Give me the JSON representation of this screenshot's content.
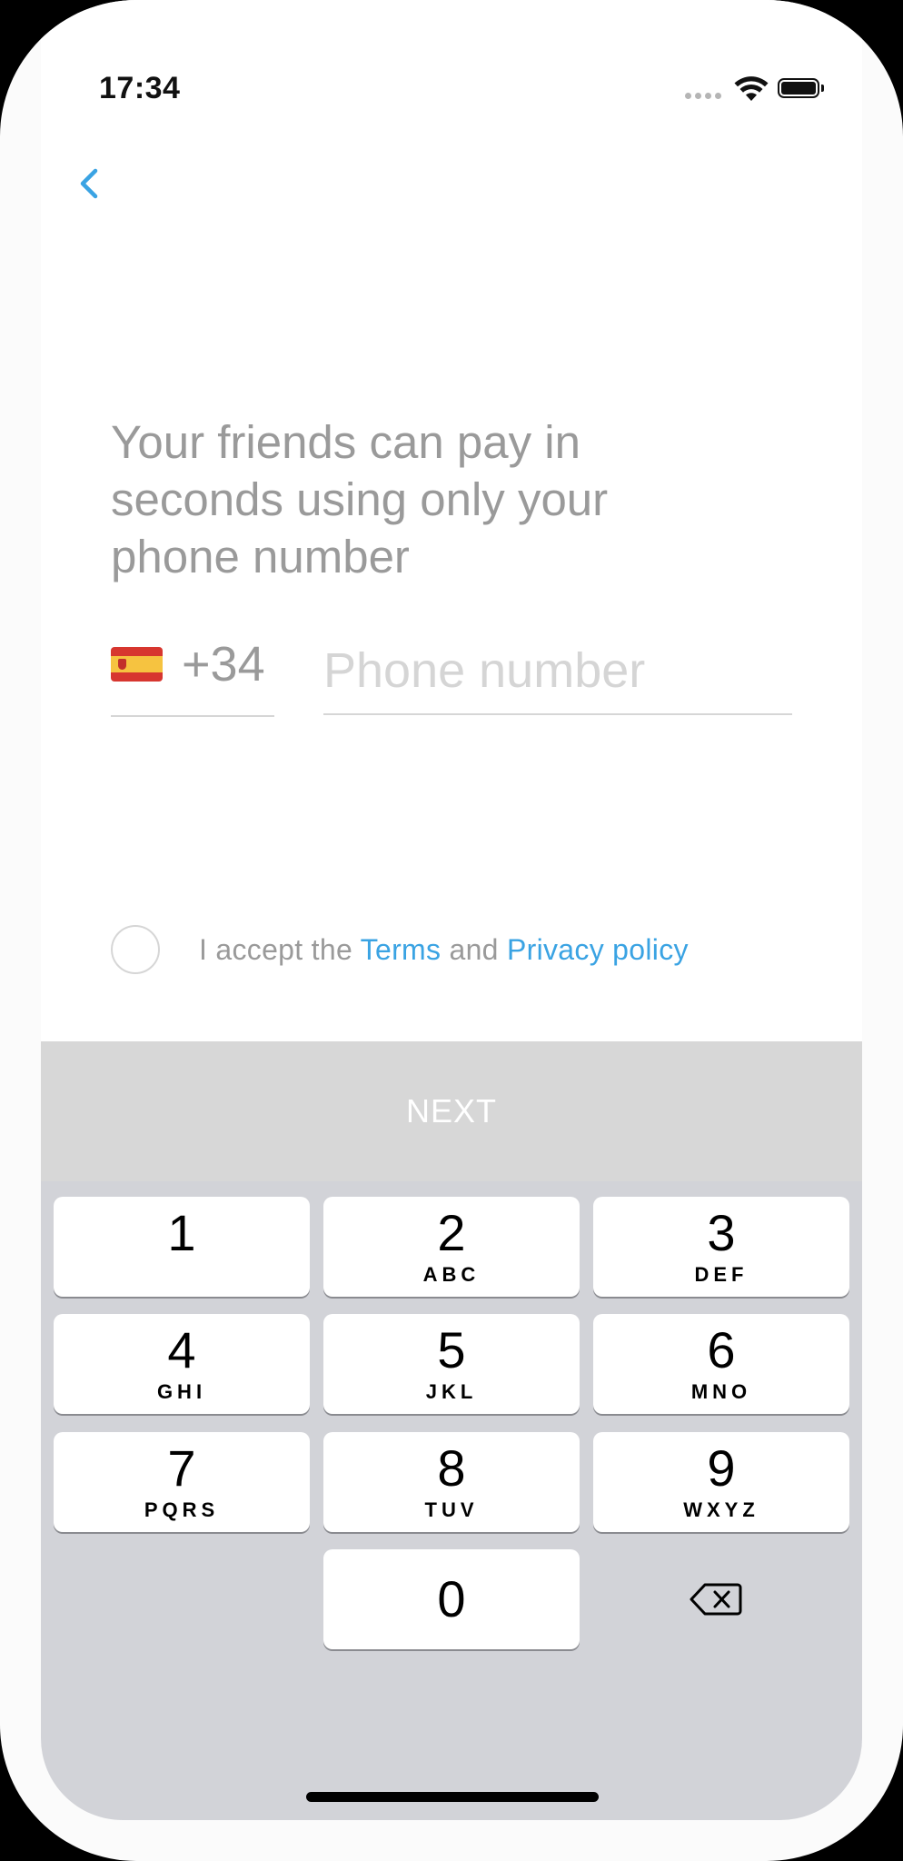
{
  "status_bar": {
    "time": "17:34"
  },
  "nav": {
    "back_icon": "chevron-left-icon"
  },
  "headline": "Your friends can pay in seconds using only your phone number",
  "phone": {
    "country_flag": "spain-flag-icon",
    "dial_code": "+34",
    "placeholder": "Phone number",
    "value": ""
  },
  "terms": {
    "prefix": "I accept the",
    "terms_link": "Terms",
    "conjunction": "and",
    "privacy_link": "Privacy policy",
    "checked": false
  },
  "next_button": {
    "label": "NEXT"
  },
  "keypad": {
    "keys": [
      {
        "num": "1",
        "letters": ""
      },
      {
        "num": "2",
        "letters": "ABC"
      },
      {
        "num": "3",
        "letters": "DEF"
      },
      {
        "num": "4",
        "letters": "GHI"
      },
      {
        "num": "5",
        "letters": "JKL"
      },
      {
        "num": "6",
        "letters": "MNO"
      },
      {
        "num": "7",
        "letters": "PQRS"
      },
      {
        "num": "8",
        "letters": "TUV"
      },
      {
        "num": "9",
        "letters": "WXYZ"
      },
      {
        "num": "0",
        "letters": ""
      }
    ],
    "delete_icon": "backspace-icon"
  },
  "colors": {
    "accent": "#3aa3e3",
    "text_muted": "#9a9a9a",
    "next_disabled": "#d7d7d7",
    "keyboard_bg": "#d2d3d8"
  }
}
